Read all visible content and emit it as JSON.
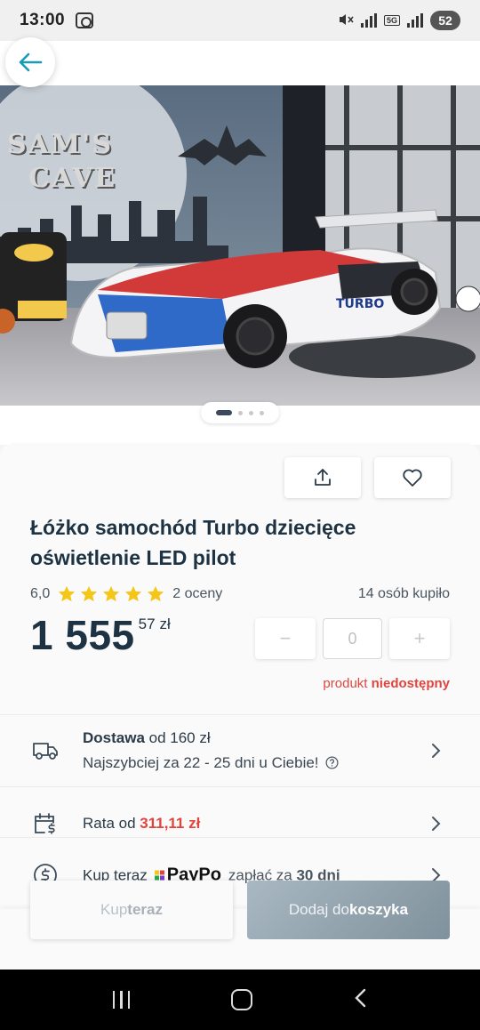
{
  "status_bar": {
    "time": "13:00",
    "network": "5G",
    "battery": "52"
  },
  "hero": {
    "wall_text_line1": "SAM'S",
    "wall_text_line2": "CAVE",
    "carousel_count": 4,
    "carousel_active": 0
  },
  "product": {
    "title": "Łóżko samochód Turbo dziecięce oświetlenie LED pilot",
    "rating_value": "6,0",
    "stars": 5,
    "ratings_count": "2 oceny",
    "buyers": "14 osób kupiło",
    "price_main": "1 555",
    "price_cents": "57",
    "currency": "zł",
    "qty_minus": "−",
    "qty_value": "0",
    "qty_plus": "+",
    "unavailable_prefix": "produkt",
    "unavailable_bold": "niedostępny"
  },
  "delivery": {
    "label_bold": "Dostawa",
    "label_rest": " od 160 zł",
    "eta": "Najszybciej za 22 - 25 dni u Ciebie!"
  },
  "installment": {
    "label": "Rata od ",
    "amount": "311,11 zł"
  },
  "paypo": {
    "prefix": "Kup teraz",
    "brand": "PayPo",
    "suffix_pre": "zapłać za ",
    "suffix_bold": "30 dni"
  },
  "actions": {
    "buy_now_pre": "Kup ",
    "buy_now_bold": "teraz",
    "add_cart_pre": "Dodaj do ",
    "add_cart_bold": "koszyka"
  },
  "colors": {
    "accent": "#1a9bb5",
    "star": "#f5c518",
    "alert": "#e0453d",
    "primary_button": "#8fa2ad",
    "title_text": "#1d3343"
  },
  "icons": [
    "back-arrow-icon",
    "share-icon",
    "heart-icon",
    "star-icon",
    "truck-icon",
    "calendar-dollar-icon",
    "dollar-circle-icon",
    "chevron-right-icon",
    "question-circle-icon"
  ]
}
